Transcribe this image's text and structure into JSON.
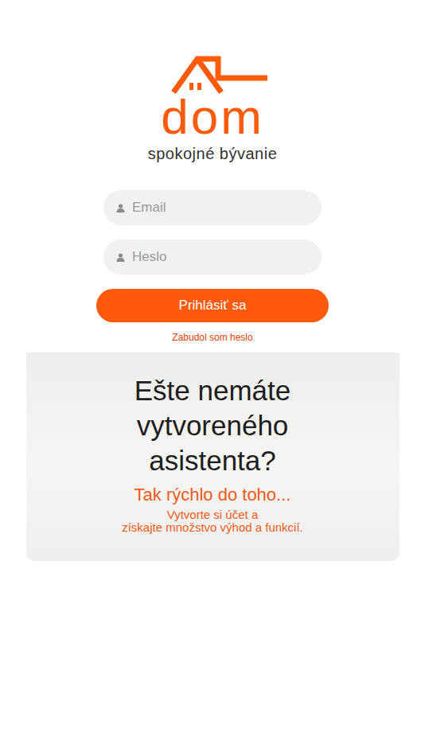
{
  "logo": {
    "brand": "dom",
    "tagline": "spokojné bývanie"
  },
  "login_form": {
    "fields": [
      {
        "kind": "text",
        "placeholder": "Email"
      },
      {
        "kind": "password",
        "placeholder": "Heslo"
      }
    ],
    "submit": "Prihlásiť sa",
    "forgot_link": "Zabudol som heslo"
  },
  "promo": {
    "title_lines": [
      "Ešte nemáte",
      "vytvoreného",
      "asistenta?"
    ],
    "headline": "Tak rýchlo do toho...",
    "text_lines": [
      "Vytvorte si účet a",
      "získajte množstvo výhod a funkcií."
    ]
  }
}
